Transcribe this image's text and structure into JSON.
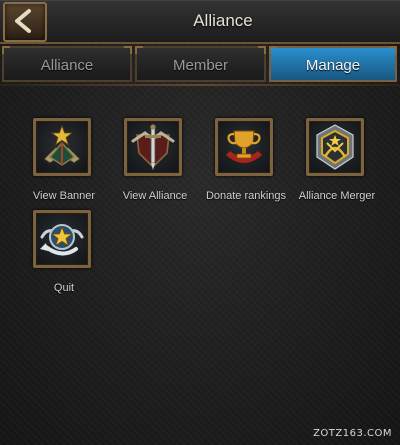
{
  "header": {
    "title": "Alliance",
    "back_icon": "chevron-left-icon"
  },
  "tabs": [
    {
      "label": "Alliance",
      "active": false
    },
    {
      "label": "Member",
      "active": false
    },
    {
      "label": "Manage",
      "active": true
    }
  ],
  "manage_options": [
    {
      "label": "View Banner",
      "icon": "banner-crest-icon"
    },
    {
      "label": "View Alliance",
      "icon": "sword-shield-icon"
    },
    {
      "label": "Donate rankings",
      "icon": "trophy-icon"
    },
    {
      "label": "Alliance Merger",
      "icon": "merge-crest-icon"
    },
    {
      "label": "Quit",
      "icon": "exit-star-icon"
    }
  ],
  "watermark": "ZOTZ163.COM",
  "colors": {
    "active_tab": "#2a8fcf",
    "frame_gold": "#7c6340",
    "background": "#1b1b1b"
  }
}
